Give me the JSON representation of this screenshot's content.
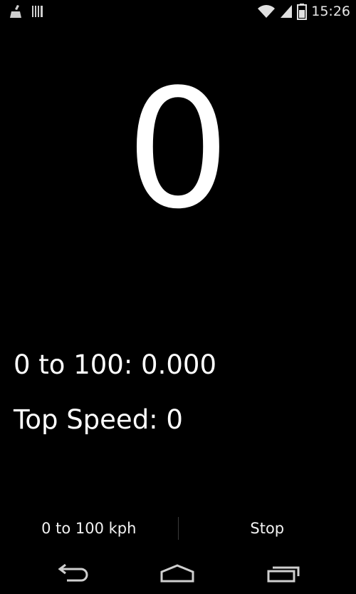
{
  "status_bar": {
    "time": "15:26",
    "left_icons": [
      "cleaner-icon",
      "barcode-icon"
    ],
    "right_icons": [
      "wifi-icon",
      "signal-icon",
      "battery-icon"
    ]
  },
  "speedometer": {
    "speed": "0"
  },
  "stats": {
    "zero_to_hundred": "0 to 100: 0.000",
    "top_speed": "Top Speed: 0"
  },
  "action_bar": {
    "mode_button": "0 to 100 kph",
    "stop_button": "Stop"
  },
  "nav_bar": {
    "icons": [
      "back-icon",
      "home-icon",
      "recent-apps-icon"
    ]
  }
}
